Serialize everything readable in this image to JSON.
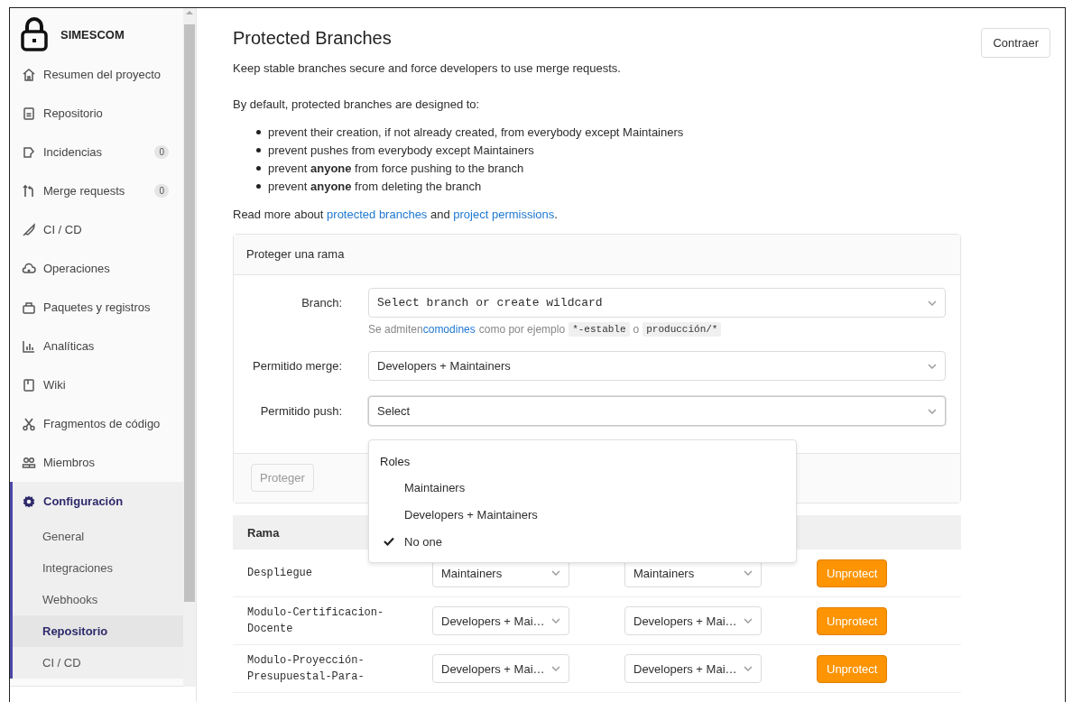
{
  "sidebar": {
    "project": "SIMESCOM",
    "items": [
      {
        "label": "Resumen del proyecto",
        "selected": false
      },
      {
        "label": "Repositorio",
        "selected": false
      },
      {
        "label": "Incidencias",
        "badge": "0",
        "selected": false
      },
      {
        "label": "Merge requests",
        "badge": "0",
        "selected": false
      },
      {
        "label": "CI / CD",
        "selected": false
      },
      {
        "label": "Operaciones",
        "selected": false
      },
      {
        "label": "Paquetes y registros",
        "selected": false
      },
      {
        "label": "Analíticas",
        "selected": false
      },
      {
        "label": "Wiki",
        "selected": false
      },
      {
        "label": "Fragmentos de código",
        "selected": false
      },
      {
        "label": "Miembros",
        "selected": false
      },
      {
        "label": "Configuración",
        "selected": true,
        "children": [
          {
            "label": "General",
            "selected": false
          },
          {
            "label": "Integraciones",
            "selected": false
          },
          {
            "label": "Webhooks",
            "selected": false
          },
          {
            "label": "Repositorio",
            "selected": true
          },
          {
            "label": "CI / CD",
            "selected": false
          }
        ]
      }
    ]
  },
  "header": {
    "title": "Protected Branches",
    "collapse_button": "Contraer"
  },
  "intro": "Keep stable branches secure and force developers to use merge requests.",
  "defaults_heading": "By default, protected branches are designed to:",
  "defaults": [
    "prevent their creation, if not already created, from everybody except Maintainers",
    "prevent pushes from everybody except Maintainers",
    "prevent **anyone** from force pushing to the branch",
    "prevent **anyone** from deleting the branch"
  ],
  "read_more": {
    "before": "Read more about ",
    "link_1": "protected branches",
    "middle": " and ",
    "link_2": "project permissions",
    "after": "."
  },
  "protect_form": {
    "title": "Proteger una rama",
    "fields": [
      {
        "label": "Branch:",
        "value": "Select branch or create wildcard",
        "kind": "mono"
      },
      {
        "label": "Permitido merge:",
        "value": "Developers + Maintainers",
        "kind": "plain"
      },
      {
        "label": "Permitido push:",
        "value": "Select",
        "kind": "focused"
      }
    ],
    "help": {
      "before": "Se admiten",
      "link": "comodines",
      "middle": "como por ejemplo",
      "code_1": "*-estable",
      "or": "o",
      "code_2": "producción/*"
    },
    "submit": "Proteger",
    "submit_disabled": true
  },
  "dropdown": {
    "heading": "Roles",
    "options": [
      {
        "label": "Maintainers",
        "selected": false
      },
      {
        "label": "Developers + Maintainers",
        "selected": false
      },
      {
        "label": "No one",
        "selected": true
      }
    ]
  },
  "table": {
    "columns": [
      "Rama"
    ],
    "rows": [
      {
        "branch": "Despliegue",
        "merge": "Maintainers",
        "push": "Maintainers",
        "action": "Unprotect"
      },
      {
        "branch": "Modulo-Certificacion-Docente",
        "merge": "Developers + Mai…",
        "push": "Developers + Mai…",
        "action": "Unprotect"
      },
      {
        "branch": "Modulo-Proyección-Presupuestal-Para-",
        "merge": "Developers + Mai…",
        "push": "Developers + Mai…",
        "action": "Unprotect"
      }
    ]
  }
}
